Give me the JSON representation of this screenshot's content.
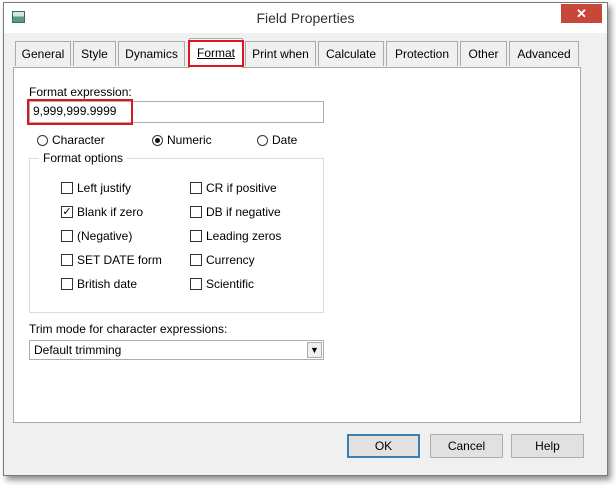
{
  "window": {
    "title": "Field Properties",
    "close_glyph": "✕"
  },
  "tabs": [
    "General",
    "Style",
    "Dynamics",
    "Format",
    "Print when",
    "Calculate",
    "Protection",
    "Other",
    "Advanced"
  ],
  "active_tab": "Format",
  "format_expression": {
    "label": "Format expression:",
    "value": "9,999,999.9999"
  },
  "expression_type": {
    "options": [
      "Character",
      "Numeric",
      "Date"
    ],
    "selected": "Numeric"
  },
  "format_options": {
    "title": "Format options",
    "left_column": [
      {
        "label": "Left justify",
        "checked": false
      },
      {
        "label": "Blank if zero",
        "checked": true
      },
      {
        "label": "(Negative)",
        "checked": false
      },
      {
        "label": "SET DATE forma",
        "checked": false
      },
      {
        "label": "British date",
        "checked": false
      }
    ],
    "right_column": [
      {
        "label": "CR if positive",
        "checked": false
      },
      {
        "label": "DB if negative",
        "checked": false
      },
      {
        "label": "Leading zeros",
        "checked": false
      },
      {
        "label": "Currency",
        "checked": false
      },
      {
        "label": "Scientific",
        "checked": false
      }
    ]
  },
  "trim_mode": {
    "label": "Trim mode for character expressions:",
    "value": "Default trimming"
  },
  "buttons": {
    "ok": "OK",
    "cancel": "Cancel",
    "help": "Help"
  },
  "icons": {
    "dropdown": "chevron-down-icon",
    "check": "check-icon"
  },
  "colors": {
    "highlight": "#e0141e",
    "close": "#c7473a",
    "default_border": "#3c7fb1"
  }
}
